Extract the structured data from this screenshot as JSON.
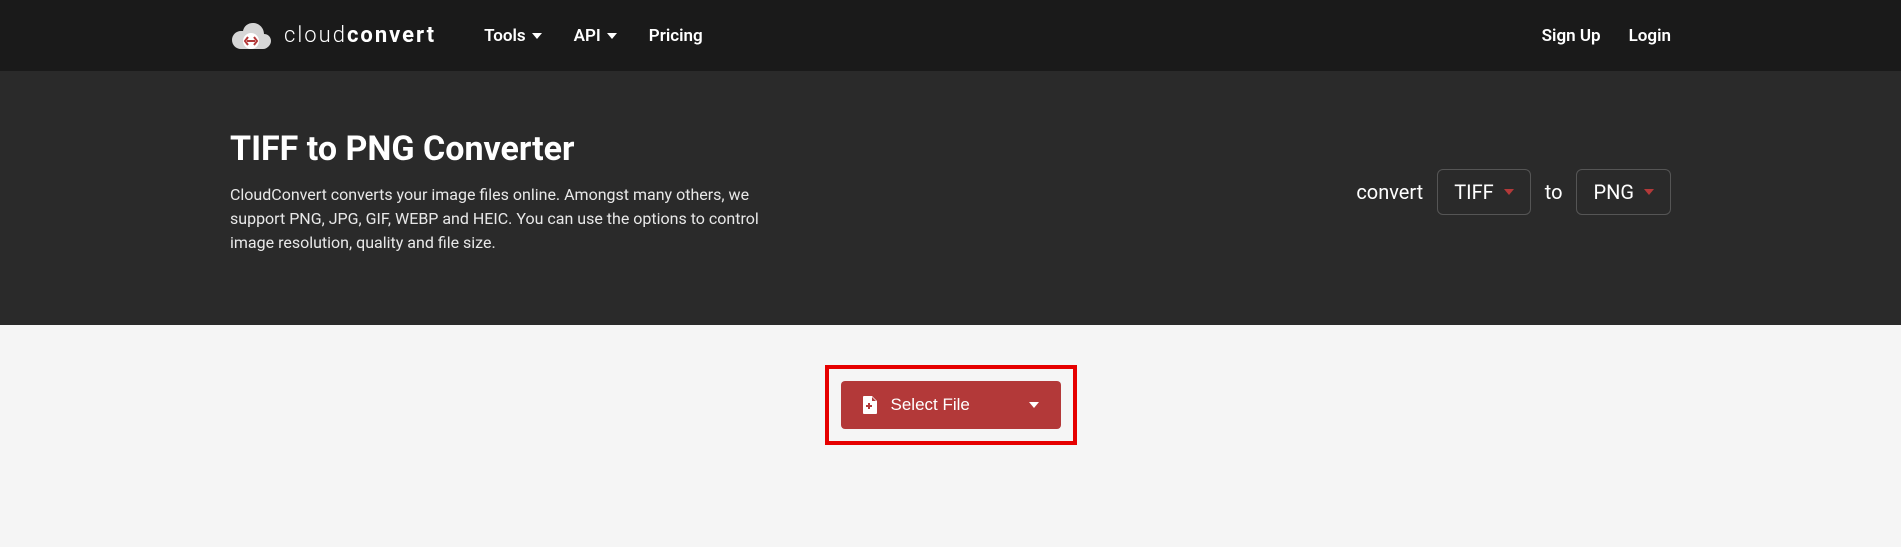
{
  "brand": {
    "name_light": "cloud",
    "name_bold": "convert"
  },
  "nav": {
    "tools": "Tools",
    "api": "API",
    "pricing": "Pricing",
    "signup": "Sign Up",
    "login": "Login"
  },
  "hero": {
    "title": "TIFF to PNG Converter",
    "description": "CloudConvert converts your image files online. Amongst many others, we support PNG, JPG, GIF, WEBP and HEIC. You can use the options to control image resolution, quality and file size."
  },
  "convert": {
    "label_convert": "convert",
    "from_format": "TIFF",
    "label_to": "to",
    "to_format": "PNG"
  },
  "actions": {
    "select_file": "Select File"
  },
  "colors": {
    "accent": "#b33939",
    "highlight_border": "#e60000"
  }
}
